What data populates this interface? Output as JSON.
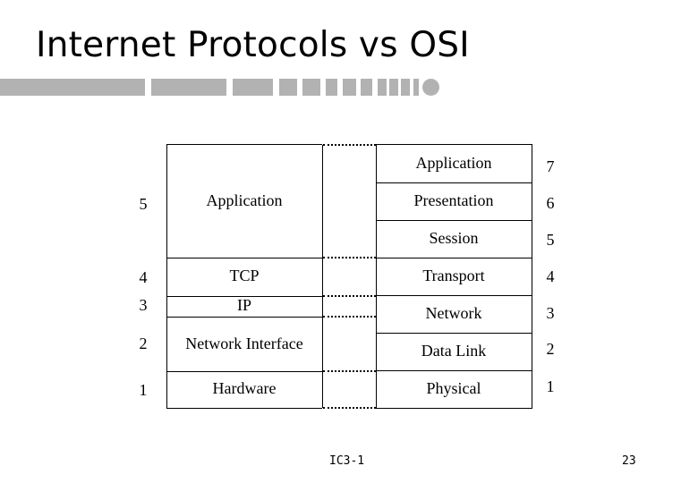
{
  "slide": {
    "title": "Internet Protocols vs OSI",
    "footer_left": "IC3-1",
    "page_number": "23",
    "accent_color": "#b2b2b2"
  },
  "internet_stack": {
    "layers": [
      {
        "number": "5",
        "label": "Application"
      },
      {
        "number": "4",
        "label": "TCP"
      },
      {
        "number": "3",
        "label": "IP"
      },
      {
        "number": "2",
        "label": "Network Interface"
      },
      {
        "number": "1",
        "label": "Hardware"
      }
    ]
  },
  "osi_stack": {
    "layers": [
      {
        "number": "7",
        "label": "Application"
      },
      {
        "number": "6",
        "label": "Presentation"
      },
      {
        "number": "5",
        "label": "Session"
      },
      {
        "number": "4",
        "label": "Transport"
      },
      {
        "number": "3",
        "label": "Network"
      },
      {
        "number": "2",
        "label": "Data Link"
      },
      {
        "number": "1",
        "label": "Physical"
      }
    ]
  }
}
